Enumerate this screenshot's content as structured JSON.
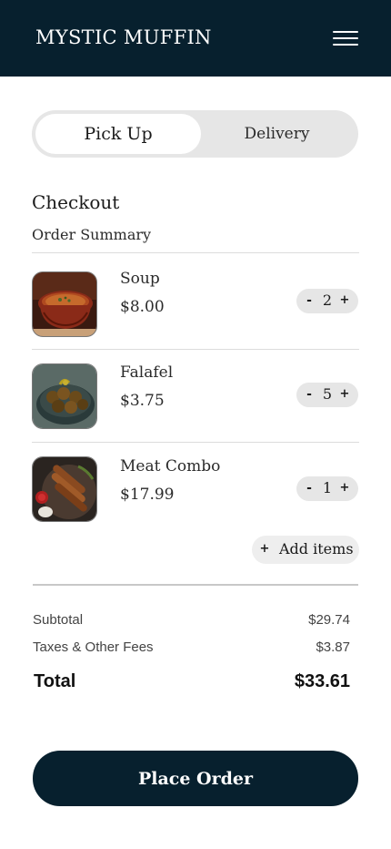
{
  "header": {
    "brand": "MYSTIC MUFFIN",
    "menu_icon": "hamburger-menu-icon",
    "background": "#07202e"
  },
  "order_type": {
    "options": [
      "Pick Up",
      "Delivery"
    ],
    "selected": "Pick Up"
  },
  "checkout": {
    "title": "Checkout",
    "summary_title": "Order Summary"
  },
  "items": [
    {
      "name": "Soup",
      "price": "$8.00",
      "quantity": "2",
      "image_icon": "soup-bowl-photo"
    },
    {
      "name": "Falafel",
      "price": "$3.75",
      "quantity": "5",
      "image_icon": "falafel-bowl-photo"
    },
    {
      "name": "Meat Combo",
      "price": "$17.99",
      "quantity": "1",
      "image_icon": "meat-platter-photo"
    }
  ],
  "stepper": {
    "minus": "-",
    "plus": "+"
  },
  "add_items": {
    "icon": "+",
    "label": "Add items"
  },
  "fees": {
    "subtotal_label": "Subtotal",
    "subtotal_value": "$29.74",
    "taxes_label": "Taxes & Other Fees",
    "taxes_value": "$3.87",
    "total_label": "Total",
    "total_value": "$33.61"
  },
  "place_order": {
    "label": "Place Order",
    "color": "#07202e"
  }
}
